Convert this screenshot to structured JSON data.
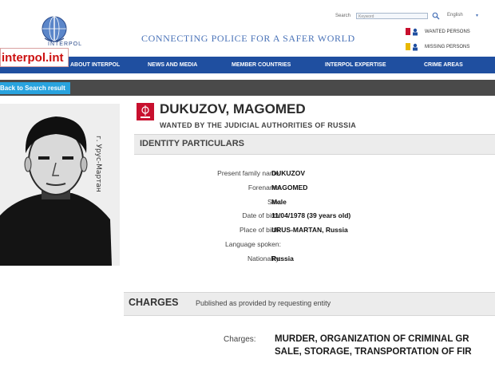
{
  "header": {
    "site_badge": "interpol.int",
    "logo_text": "INTERPOL",
    "tagline": "CONNECTING POLICE FOR A SAFER WORLD",
    "search_label": "Search",
    "search_placeholder": "Keyword",
    "language": "English",
    "wanted_persons": "WANTED PERSONS",
    "missing_persons": "MISSING PERSONS"
  },
  "nav": [
    {
      "label": "ABOUT INTERPOL"
    },
    {
      "label": "NEWS AND MEDIA"
    },
    {
      "label": "MEMBER COUNTRIES"
    },
    {
      "label": "INTERPOL EXPERTISE"
    },
    {
      "label": "CRIME AREAS"
    }
  ],
  "toolbar": {
    "back_label": "Back to Search result"
  },
  "photo": {
    "stamp_text": "г. Урус-Мартан"
  },
  "person": {
    "name": "DUKUZOV, MAGOMED",
    "wanted_by": "WANTED BY THE JUDICIAL AUTHORITIES OF RUSSIA"
  },
  "identity": {
    "title": "IDENTITY PARTICULARS",
    "fields": [
      {
        "label": "Present family name:",
        "value": "DUKUZOV"
      },
      {
        "label": "Forename:",
        "value": "MAGOMED"
      },
      {
        "label": "Sex:",
        "value": "Male"
      },
      {
        "label": "Date of birth:",
        "value": "11/04/1978 (39 years old)"
      },
      {
        "label": "Place of birth:",
        "value": "URUS-MARTAN, Russia"
      },
      {
        "label": "Language spoken:",
        "value": ""
      },
      {
        "label": "Nationality:",
        "value": "Russia"
      }
    ]
  },
  "charges": {
    "title": "CHARGES",
    "subtitle": "Published as provided by requesting entity",
    "label": "Charges:",
    "line1": "MURDER, ORGANIZATION OF CRIMINAL GR",
    "line2": "SALE, STORAGE, TRANSPORTATION OF FIR"
  },
  "colors": {
    "nav": "#1f4fa0",
    "accent": "#29a3de",
    "brand_red": "#c8102e"
  }
}
